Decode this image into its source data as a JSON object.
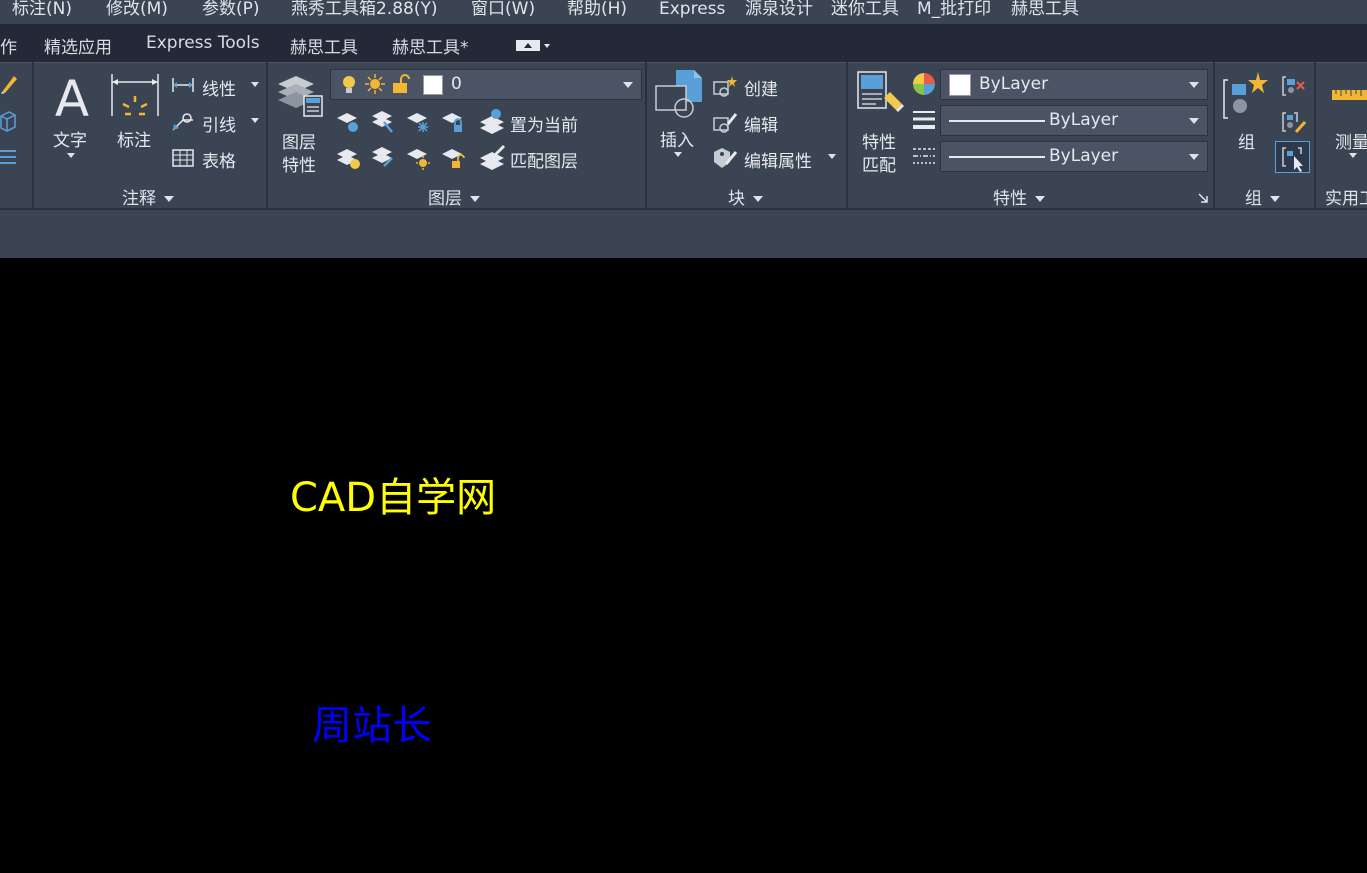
{
  "menubar": {
    "items": [
      "标注(N)",
      "修改(M)",
      "参数(P)",
      "燕秀工具箱2.88(Y)",
      "窗口(W)",
      "帮助(H)",
      "Express",
      "源泉设计",
      "迷你工具",
      "M_批打印",
      "赫思工具"
    ]
  },
  "tabs": [
    "作",
    "精选应用",
    "Express Tools",
    "赫思工具",
    "赫思工具*"
  ],
  "annotation_panel": {
    "title": "注释",
    "text_button": "文字",
    "dimension_button": "标注",
    "linear_button": "线性",
    "leader_button": "引线",
    "table_button": "表格"
  },
  "layers_panel": {
    "title": "图层",
    "layer_properties_line1": "图层",
    "layer_properties_line2": "特性",
    "current_layer": "0",
    "set_current_button": "置为当前",
    "match_layer_button": "匹配图层"
  },
  "block_panel": {
    "title": "块",
    "insert_button": "插入",
    "create_button": "创建",
    "edit_button": "编辑",
    "edit_attributes_button": "编辑属性"
  },
  "properties_panel": {
    "title": "特性",
    "match_properties_line1": "特性",
    "match_properties_line2": "匹配",
    "color_value": "ByLayer",
    "lineweight_value": "ByLayer",
    "linetype_value": "ByLayer"
  },
  "groups_panel": {
    "title": "组",
    "group_button": "组"
  },
  "utilities_panel": {
    "title": "实用工",
    "measure_button": "测量"
  },
  "canvas": {
    "texts": [
      {
        "text": "CAD自学网",
        "color": "#ffff00"
      },
      {
        "text": "周站长",
        "color": "#0000ff"
      }
    ]
  },
  "colors": {
    "menubar_bg": "#3b4453",
    "tabbar_bg": "#232936",
    "ribbon_bg": "#3b4453",
    "canvas_bg": "#000000",
    "accent_blue": "#5aa0d8",
    "accent_yellow": "#f2b632"
  }
}
